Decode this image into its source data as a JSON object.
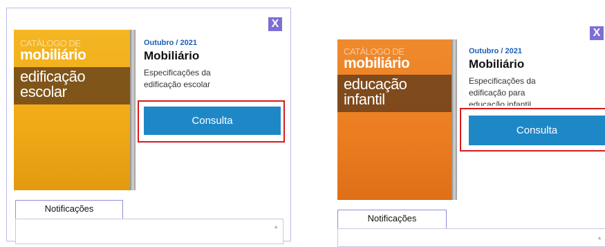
{
  "left_card": {
    "close_label": "X",
    "cover": {
      "line1": "CATÁLOGO DE",
      "line2": "mobiliário",
      "line3a": "edificação",
      "line3b": "escolar",
      "color": "#f2b01e"
    },
    "date": "Outubro / 2021",
    "title": "Mobiliário",
    "description_l1": "Especificações da",
    "description_l2": "edificação escolar",
    "button_label": "Consulta",
    "notifications_tab": "Notificações"
  },
  "right_card": {
    "close_label": "X",
    "cover": {
      "line1": "CATÁLOGO DE",
      "line2": "mobiliário",
      "line3a": "educação",
      "line3b": "infantil",
      "color": "#ee7f22"
    },
    "date": "Outubro / 2021",
    "title": "Mobiliário",
    "description_l1": "Especificações da",
    "description_l2": "edificação para",
    "description_l3": "educação infantil",
    "button_label": "Consulta",
    "notifications_tab": "Notificações"
  },
  "colors": {
    "button": "#1e88c7",
    "highlight": "#d7191c",
    "close": "#7b6fd6",
    "date": "#1a5fb4"
  }
}
